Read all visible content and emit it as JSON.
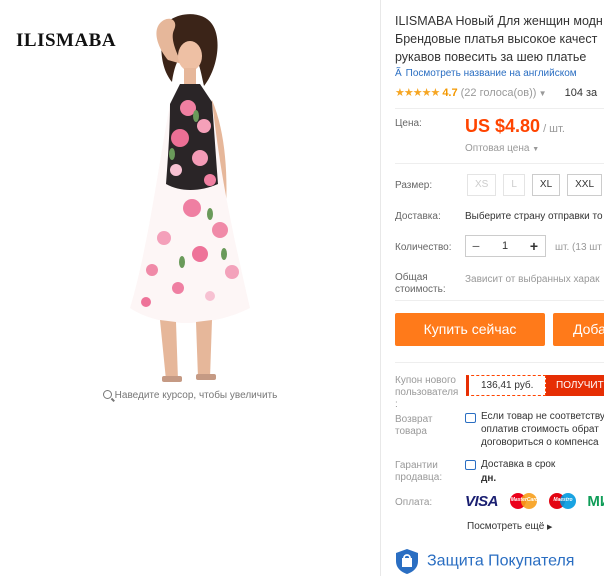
{
  "gallery": {
    "brand_logo": "ILISMABA",
    "zoom_hint": "Наведите курсор, чтобы увеличить"
  },
  "product": {
    "title_lines": [
      "ILISMABA Новый Для женщин модн",
      "Брендовые платья высокое качест",
      "рукавов повесить за шею платье"
    ],
    "translate_link": "Посмотреть название на английском",
    "rating": {
      "stars": 4.7,
      "value": "4.7",
      "votes": "(22 голоса(ов))",
      "orders": "104 за"
    }
  },
  "price": {
    "label": "Цена:",
    "value": "US $4.80",
    "unit": "/ шт.",
    "wholesale": "Оптовая цена"
  },
  "sizes": {
    "label": "Размер:",
    "options": [
      {
        "label": "XS",
        "available": false
      },
      {
        "label": "L",
        "available": false
      },
      {
        "label": "XL",
        "available": true
      },
      {
        "label": "XXL",
        "available": true
      }
    ]
  },
  "shipping": {
    "label": "Доставка:",
    "text": "Выберите страну отправки то"
  },
  "quantity": {
    "label": "Количество:",
    "value": "1",
    "minus": "−",
    "plus": "+",
    "available": "шт. (13 шт"
  },
  "total": {
    "label_lines": [
      "Общая",
      "стоимость:"
    ],
    "text": "Зависит от выбранных харак"
  },
  "actions": {
    "buy_now": "Купить сейчас",
    "add_to_cart": "Доба"
  },
  "coupon": {
    "label_lines": [
      "Купон нового",
      "пользователя",
      ":"
    ],
    "amount": "136,41 руб.",
    "get": "ПОЛУЧИТ"
  },
  "returns": {
    "label_lines": [
      "Возврат",
      "товара"
    ],
    "lines": [
      "Если товар не соответствует",
      "оплатив стоимость обрат",
      "договориться о компенса"
    ]
  },
  "guarantee": {
    "label_lines": [
      "Гарантии",
      "продавца:"
    ],
    "line1": "Доставка в срок",
    "line2": "дн."
  },
  "payment": {
    "label": "Оплата:",
    "visa": "VISA",
    "mastercard": "MasterCard",
    "maestro": "Maestro",
    "mir": "МИ",
    "more": "Посмотреть ещё"
  },
  "protection": {
    "title": "Защита Покупателя"
  },
  "colors": {
    "accent_orange": "#ff7a1a",
    "price_red": "#ff4400",
    "coupon_red": "#e62e04",
    "link_blue": "#2a6ec2",
    "star_gold": "#f6a623"
  }
}
